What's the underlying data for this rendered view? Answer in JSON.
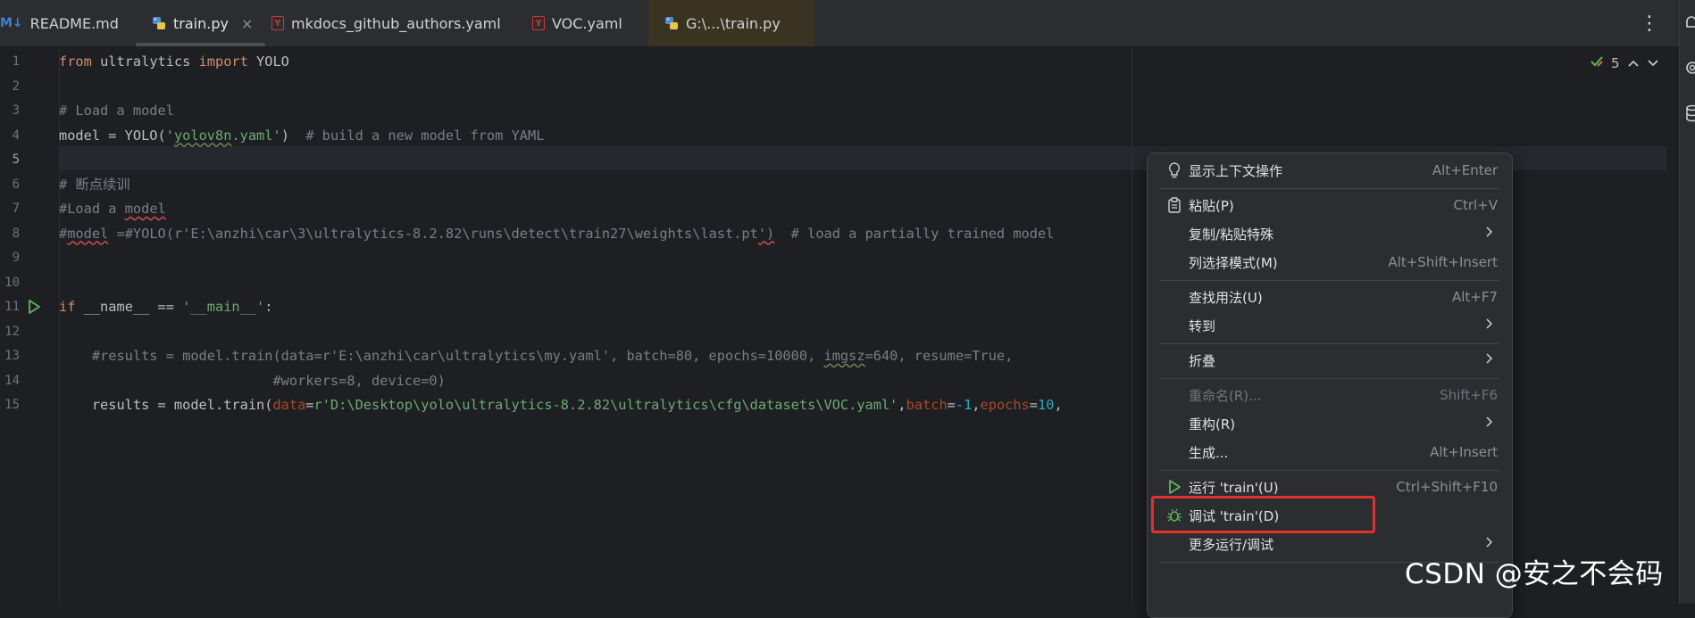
{
  "tabs": [
    {
      "label": "README.md",
      "icon": "markdown-icon",
      "glyph": "M↓"
    },
    {
      "label": "train.py",
      "icon": "python-file-icon",
      "close": "×",
      "active": true
    },
    {
      "label": "mkdocs_github_authors.yaml",
      "icon": "yaml-file-icon",
      "glyph": "Y"
    },
    {
      "label": "VOC.yaml",
      "icon": "yaml-file-icon",
      "glyph": "Y"
    },
    {
      "label": "G:\\...\\train.py",
      "icon": "python-file-icon"
    }
  ],
  "tab_menu_glyph": "⋮",
  "inspection": {
    "count": "5"
  },
  "editor": {
    "current_line": 5,
    "line_numbers": [
      "1",
      "2",
      "3",
      "4",
      "5",
      "6",
      "7",
      "8",
      "9",
      "10",
      "11",
      "12",
      "13",
      "14",
      "15"
    ],
    "lines": [
      {
        "n": "1",
        "tokens": [
          {
            "t": "from ",
            "c": "kw"
          },
          {
            "t": "ultralytics "
          },
          {
            "t": "import ",
            "c": "kw"
          },
          {
            "t": "YOLO"
          }
        ]
      },
      {
        "n": "2",
        "tokens": []
      },
      {
        "n": "3",
        "tokens": [
          {
            "t": "# Load a model",
            "c": "cm"
          }
        ]
      },
      {
        "n": "4",
        "tokens": [
          {
            "t": "model = YOLO("
          },
          {
            "t": "'",
            "c": "st"
          },
          {
            "t": "yolov8n",
            "c": "st sq"
          },
          {
            "t": ".yaml'",
            "c": "st"
          },
          {
            "t": ")  "
          },
          {
            "t": "# build a new model from YAML",
            "c": "cm"
          }
        ]
      },
      {
        "n": "5",
        "tokens": []
      },
      {
        "n": "6",
        "tokens": [
          {
            "t": "# 断点续训",
            "c": "cm"
          }
        ]
      },
      {
        "n": "7",
        "tokens": [
          {
            "t": "#Load a ",
            "c": "cm"
          },
          {
            "t": "model",
            "c": "cm sq-red"
          }
        ]
      },
      {
        "n": "8",
        "tokens": [
          {
            "t": "#",
            "c": "cm"
          },
          {
            "t": "model",
            "c": "cm sq-red"
          },
          {
            "t": " =#YOLO(r'E:\\anzhi\\car\\3\\ultralytics-8.2.82\\runs\\detect\\train27\\weights\\last.pt",
            "c": "cm"
          },
          {
            "t": "')",
            "c": "cm sq-red"
          },
          {
            "t": "  # load a partially trained model",
            "c": "cm"
          }
        ]
      },
      {
        "n": "9",
        "tokens": []
      },
      {
        "n": "10",
        "tokens": []
      },
      {
        "n": "11",
        "tokens": [
          {
            "t": "if ",
            "c": "kw"
          },
          {
            "t": "__name__ == "
          },
          {
            "t": "'__main__'",
            "c": "st"
          },
          {
            "t": ":"
          }
        ]
      },
      {
        "n": "12",
        "tokens": []
      },
      {
        "n": "13",
        "tokens": [
          {
            "t": "    #results = model.train(data=r'E:\\anzhi\\car\\ultralytics\\my.yaml', batch=80, epochs=10000, ",
            "c": "cm"
          },
          {
            "t": "imgsz",
            "c": "cm sq"
          },
          {
            "t": "=640, resume=True,",
            "c": "cm"
          }
        ]
      },
      {
        "n": "14",
        "tokens": [
          {
            "t": "                          #workers=8, device=0)",
            "c": "cm"
          }
        ]
      },
      {
        "n": "15",
        "tokens": [
          {
            "t": "    results = model.train("
          },
          {
            "t": "data",
            "c": "pn"
          },
          {
            "t": "="
          },
          {
            "t": "r'D:\\Desktop\\yolo\\ultralytics-8.2.82\\ultralytics\\cfg\\datasets\\VOC.yaml'",
            "c": "st"
          },
          {
            "t": ","
          },
          {
            "t": "batch",
            "c": "pn"
          },
          {
            "t": "="
          },
          {
            "t": "-1",
            "c": "nm"
          },
          {
            "t": ","
          },
          {
            "t": "epochs",
            "c": "pn"
          },
          {
            "t": "="
          },
          {
            "t": "10",
            "c": "nm"
          },
          {
            "t": ","
          }
        ]
      }
    ]
  },
  "context_menu": {
    "items": [
      {
        "label": "显示上下文操作",
        "shortcut": "Alt+Enter",
        "icon": "lightbulb-icon"
      },
      {
        "sep": true
      },
      {
        "label": "粘贴(P)",
        "shortcut": "Ctrl+V",
        "icon": "clipboard-icon"
      },
      {
        "label": "复制/粘贴特殊",
        "submenu": true
      },
      {
        "label": "列选择模式(M)",
        "shortcut": "Alt+Shift+Insert"
      },
      {
        "sep": true
      },
      {
        "label": "查找用法(U)",
        "shortcut": "Alt+F7"
      },
      {
        "label": "转到",
        "submenu": true
      },
      {
        "sep": true
      },
      {
        "label": "折叠",
        "submenu": true
      },
      {
        "sep": true
      },
      {
        "label": "重命名(R)...",
        "shortcut": "Shift+F6",
        "disabled": true
      },
      {
        "label": "重构(R)",
        "submenu": true
      },
      {
        "label": "生成...",
        "shortcut": "Alt+Insert"
      },
      {
        "sep": true
      },
      {
        "label": "运行 'train'(U)",
        "shortcut": "Ctrl+Shift+F10",
        "icon": "run-icon"
      },
      {
        "label": "调试 'train'(D)",
        "icon": "debug-icon"
      },
      {
        "label": "更多运行/调试",
        "submenu": true
      },
      {
        "sep": true
      }
    ]
  },
  "watermark": "CSDN @安之不会码",
  "colors": {
    "accent_red": "#e0312c",
    "run_green": "#5fb85c"
  }
}
